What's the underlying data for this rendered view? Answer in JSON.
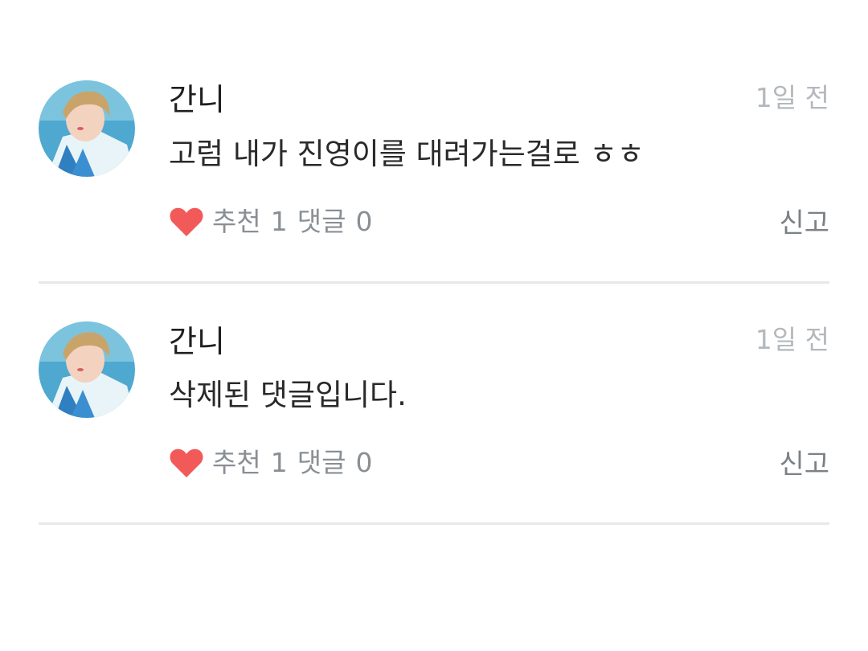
{
  "comments": [
    {
      "author": "간니",
      "time": "1일 전",
      "text": "고럼 내가 진영이를 대려가는걸로 ㅎㅎ",
      "like_label": "추천",
      "like_count": "1",
      "reply_label": "댓글",
      "reply_count": "0",
      "report_label": "신고"
    },
    {
      "author": "간니",
      "time": "1일 전",
      "text": "삭제된 댓글입니다.",
      "like_label": "추천",
      "like_count": "1",
      "reply_label": "댓글",
      "reply_count": "0",
      "report_label": "신고"
    }
  ],
  "colors": {
    "heart": "#f25a5a",
    "divider": "#e6e8ea",
    "meta": "#8a8f94"
  },
  "icons": {
    "like": "heart-icon",
    "avatar": "avatar"
  }
}
